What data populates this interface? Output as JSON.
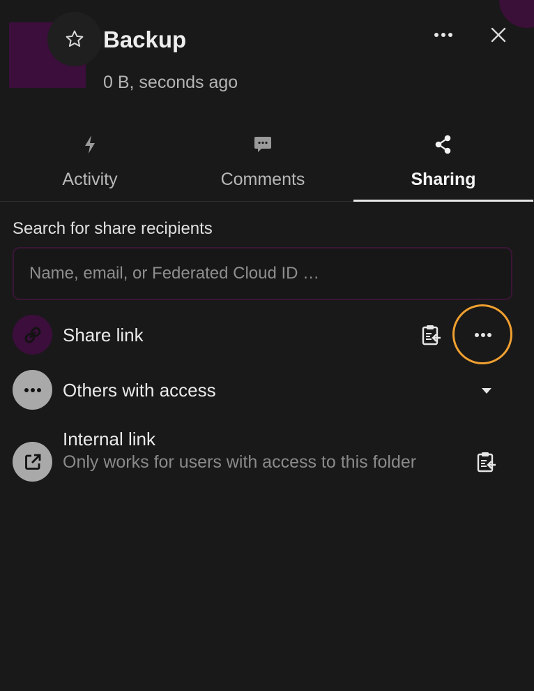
{
  "file": {
    "name": "Backup",
    "meta": "0 B, seconds ago"
  },
  "tabs": [
    {
      "label": "Activity",
      "icon": "lightning-icon"
    },
    {
      "label": "Comments",
      "icon": "comment-icon"
    },
    {
      "label": "Sharing",
      "icon": "share-icon",
      "active": true
    }
  ],
  "search": {
    "label": "Search for share recipients",
    "placeholder": "Name, email, or Federated Cloud ID …"
  },
  "share_link": {
    "label": "Share link"
  },
  "others": {
    "label": "Others with access"
  },
  "internal_link": {
    "label": "Internal link",
    "description": "Only works for users with access to this folder"
  },
  "colors": {
    "background": "#191919",
    "accent_purple": "#3b0e3b",
    "highlight_orange": "#f0a030"
  }
}
